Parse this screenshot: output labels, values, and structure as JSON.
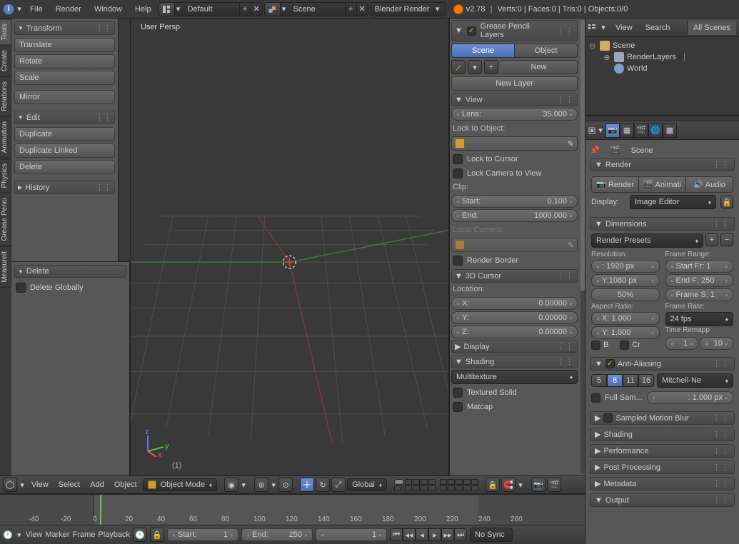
{
  "topbar": {
    "menus": [
      "File",
      "Render",
      "Window",
      "Help"
    ],
    "layout": "Default",
    "scene": "Scene",
    "engine": "Blender Render",
    "version": "v2.78",
    "stats": "Verts:0 | Faces:0 | Tris:0 | Objects:0/0"
  },
  "tool_tabs": [
    "Tools",
    "Create",
    "Relations",
    "Animation",
    "Physics",
    "Grease Penci",
    "Measureit"
  ],
  "tool_shelf": {
    "transform": {
      "title": "Transform",
      "items": [
        "Translate",
        "Rotate",
        "Scale",
        "Mirror"
      ]
    },
    "edit": {
      "title": "Edit",
      "items": [
        "Duplicate",
        "Duplicate Linked",
        "Delete"
      ]
    },
    "history": {
      "title": "History"
    }
  },
  "tool_shelf_lower": {
    "delete": {
      "title": "Delete",
      "globally": "Delete Globally"
    }
  },
  "viewport": {
    "persp": "User Persp",
    "num": "(1)"
  },
  "nprops": {
    "gp": {
      "title": "Grease Pencil Layers",
      "scene": "Scene",
      "object": "Object",
      "new": "New",
      "newlayer": "New Layer"
    },
    "view": {
      "title": "View",
      "lens_label": "Lens:",
      "lens": "35.000",
      "lock_obj": "Lock to Object:",
      "lock_cursor": "Lock to Cursor",
      "lock_cam": "Lock Camera to View",
      "clip": "Clip:",
      "start_l": "Start:",
      "start": "0.100",
      "end_l": "End:",
      "end": "1000.000",
      "local_cam": "Local Camera:",
      "render_border": "Render Border"
    },
    "cursor": {
      "title": "3D Cursor",
      "loc": "Location:",
      "x_l": "X:",
      "x": "0.00000",
      "y_l": "Y:",
      "y": "0.00000",
      "z_l": "Z:",
      "z": "0.00000"
    },
    "display": {
      "title": "Display"
    },
    "shading": {
      "title": "Shading",
      "mode": "Multitexture",
      "tex_solid": "Textured Solid",
      "matcap": "Matcap"
    }
  },
  "view_header": {
    "menus": [
      "View",
      "Select",
      "Add",
      "Object"
    ],
    "mode": "Object Mode",
    "orient": "Global"
  },
  "timeline": {
    "ticks": [
      "-40",
      "-20",
      "0",
      "20",
      "40",
      "60",
      "80",
      "100",
      "120",
      "140",
      "160",
      "180",
      "200",
      "220",
      "240",
      "260"
    ],
    "menus": [
      "View",
      "Marker",
      "Frame",
      "Playback"
    ],
    "start_l": "Start:",
    "start": "1",
    "end_l": "End:",
    "end": "250",
    "cur": "1",
    "sync": "No Sync"
  },
  "outliner": {
    "menus": [
      "View",
      "Search"
    ],
    "tab": "All Scenes",
    "scene": "Scene",
    "render": "RenderLayers",
    "world": "World"
  },
  "props": {
    "context": "Scene",
    "render": {
      "title": "Render",
      "render": "Render",
      "anim": "Animati",
      "audio": "Audio",
      "display_l": "Display:",
      "display": "Image Editor"
    },
    "dimensions": {
      "title": "Dimensions",
      "presets": "Render Presets",
      "res_l": "Resolution:",
      "res_x": ": 1920 px",
      "res_y": "Y:1080 px",
      "res_pct": "50%",
      "fr_l": "Frame Range:",
      "fr_start": "Start Fr: 1",
      "fr_end": "End F: 250",
      "fr_step": "Frame S: 1",
      "ar_l": "Aspect Ratio:",
      "ar_x": "X:   1.000",
      "ar_y": "Y:   1.000",
      "frate_l": "Frame Rate:",
      "frate": "24 fps",
      "remap": "Time Remapp",
      "b": "B",
      "cr": "Cr",
      "old": "1",
      "new": "10"
    },
    "aa": {
      "title": "Anti-Aliasing",
      "samples": [
        "5",
        "8",
        "11",
        "16"
      ],
      "filter": "Mitchell-Ne",
      "full": "Full Sam...",
      "size": ": 1.000 px"
    },
    "collapsed": [
      "Sampled Motion Blur",
      "Shading",
      "Performance",
      "Post Processing",
      "Metadata",
      "Output"
    ]
  }
}
